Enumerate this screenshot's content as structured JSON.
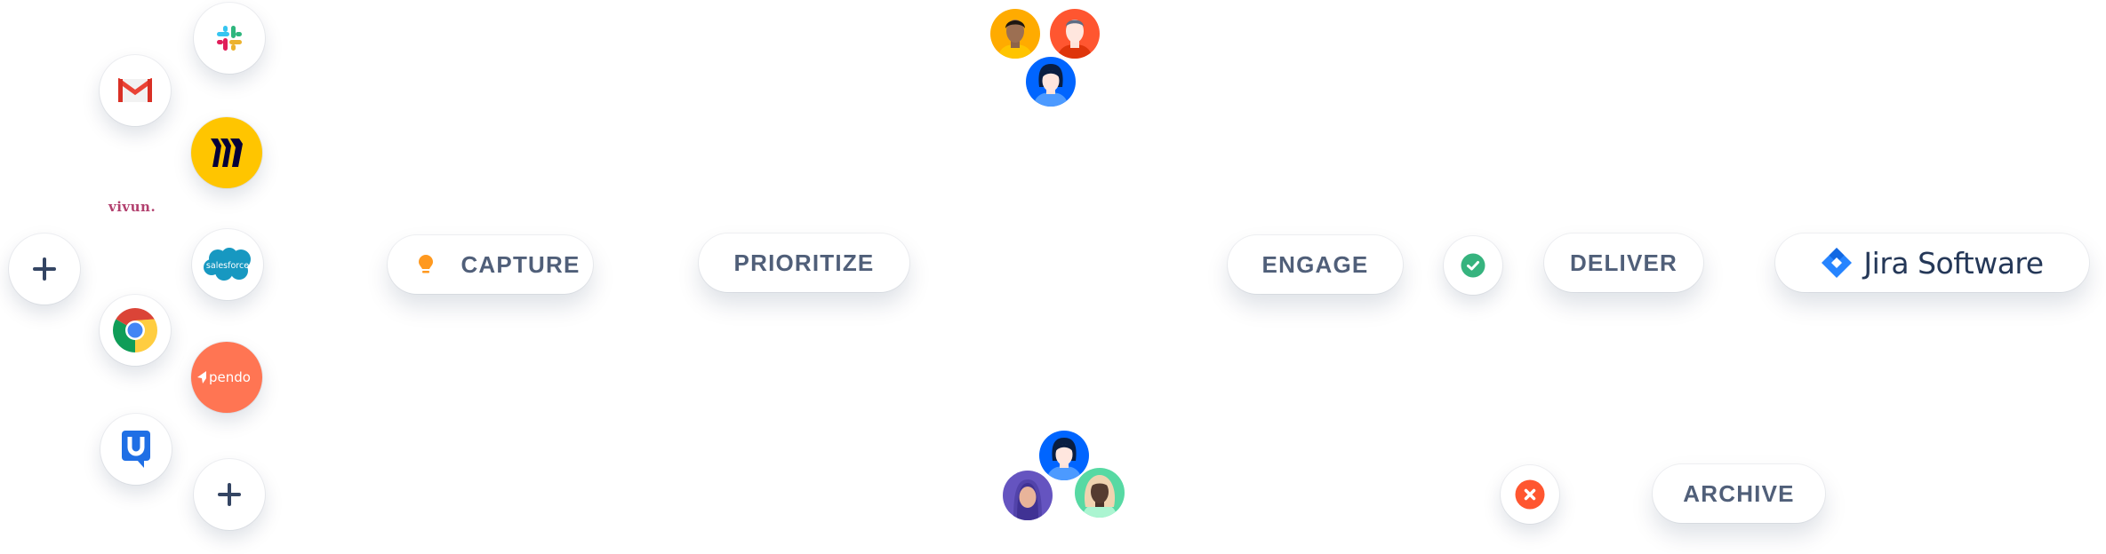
{
  "integrations": {
    "items": [
      {
        "name": "Slack",
        "icon": "slack-icon"
      },
      {
        "name": "Gmail",
        "icon": "gmail-icon"
      },
      {
        "name": "Miro",
        "icon": "miro-icon",
        "bg": "#FFC500"
      },
      {
        "name": "vivun.",
        "icon": "vivun-logo",
        "color": "#B2406E"
      },
      {
        "name": "Add integration",
        "icon": "plus-icon"
      },
      {
        "name": "salesforce",
        "icon": "salesforce-icon",
        "color": "#1798C1"
      },
      {
        "name": "Chrome",
        "icon": "chrome-icon"
      },
      {
        "name": "pendo",
        "icon": "pendo-icon",
        "bg": "#FF7553"
      },
      {
        "name": "UserTesting",
        "icon": "usertesting-icon",
        "color": "#1F6FE5"
      },
      {
        "name": "Add integration",
        "icon": "plus-icon"
      }
    ]
  },
  "workflow": {
    "capture": {
      "label": "CAPTURE",
      "icon": "lightbulb-icon",
      "icon_color": "#FF991F"
    },
    "prioritize": {
      "label": "PRIORITIZE"
    },
    "engage": {
      "label": "ENGAGE"
    },
    "deliver": {
      "label": "DELIVER"
    },
    "archive": {
      "label": "ARCHIVE"
    },
    "approved": {
      "icon": "check-circle-icon",
      "color": "#36B37E"
    },
    "rejected": {
      "icon": "close-circle-icon",
      "color": "#FF5630"
    },
    "destination": {
      "label": "Jira Software",
      "icon": "jira-icon",
      "color": "#2684FF"
    }
  },
  "teams": {
    "top": [
      {
        "name": "team-member-1",
        "bg": "#FFAB00"
      },
      {
        "name": "team-member-2",
        "bg": "#FF5630"
      },
      {
        "name": "team-member-3",
        "bg": "#0065FF"
      }
    ],
    "bottom": [
      {
        "name": "team-member-4",
        "bg": "#0065FF"
      },
      {
        "name": "team-member-5",
        "bg": "#6554C0"
      },
      {
        "name": "team-member-6",
        "bg": "#57D9A3"
      }
    ]
  },
  "colors": {
    "text": "#505F79",
    "jira_text": "#253858",
    "plus": "#344563"
  }
}
